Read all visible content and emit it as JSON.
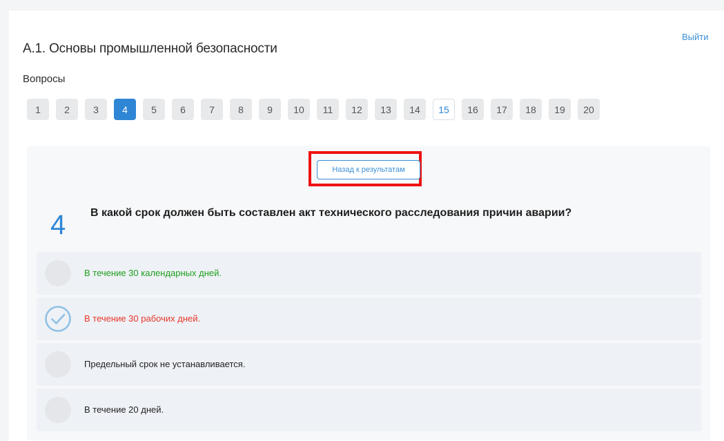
{
  "header": {
    "logout_label": "Выйти",
    "title": "А.1. Основы промышленной безопасности",
    "questions_label": "Вопросы"
  },
  "pager": {
    "items": [
      "1",
      "2",
      "3",
      "4",
      "5",
      "6",
      "7",
      "8",
      "9",
      "10",
      "11",
      "12",
      "13",
      "14",
      "15",
      "16",
      "17",
      "18",
      "19",
      "20"
    ],
    "active": "4",
    "current": "15"
  },
  "back_button_label": "Назад к результатам",
  "question": {
    "number": "4",
    "text": "В какой срок должен быть составлен акт технического расследования причин аварии?"
  },
  "answers": [
    {
      "text": "В течение 30 календарных дней.",
      "state": "correct",
      "color": "#1f9e1f"
    },
    {
      "text": "В течение 30 рабочих дней.",
      "state": "selected-wrong",
      "color": "#e8372c"
    },
    {
      "text": "Предельный срок не устанавливается.",
      "state": "neutral",
      "color": "#222222"
    },
    {
      "text": "В течение 20 дней.",
      "state": "neutral",
      "color": "#222222"
    }
  ],
  "colors": {
    "accent": "#2f86d5",
    "highlight_box": "#ee1111"
  },
  "icons": {
    "selected_answer": "check-circle-icon"
  }
}
